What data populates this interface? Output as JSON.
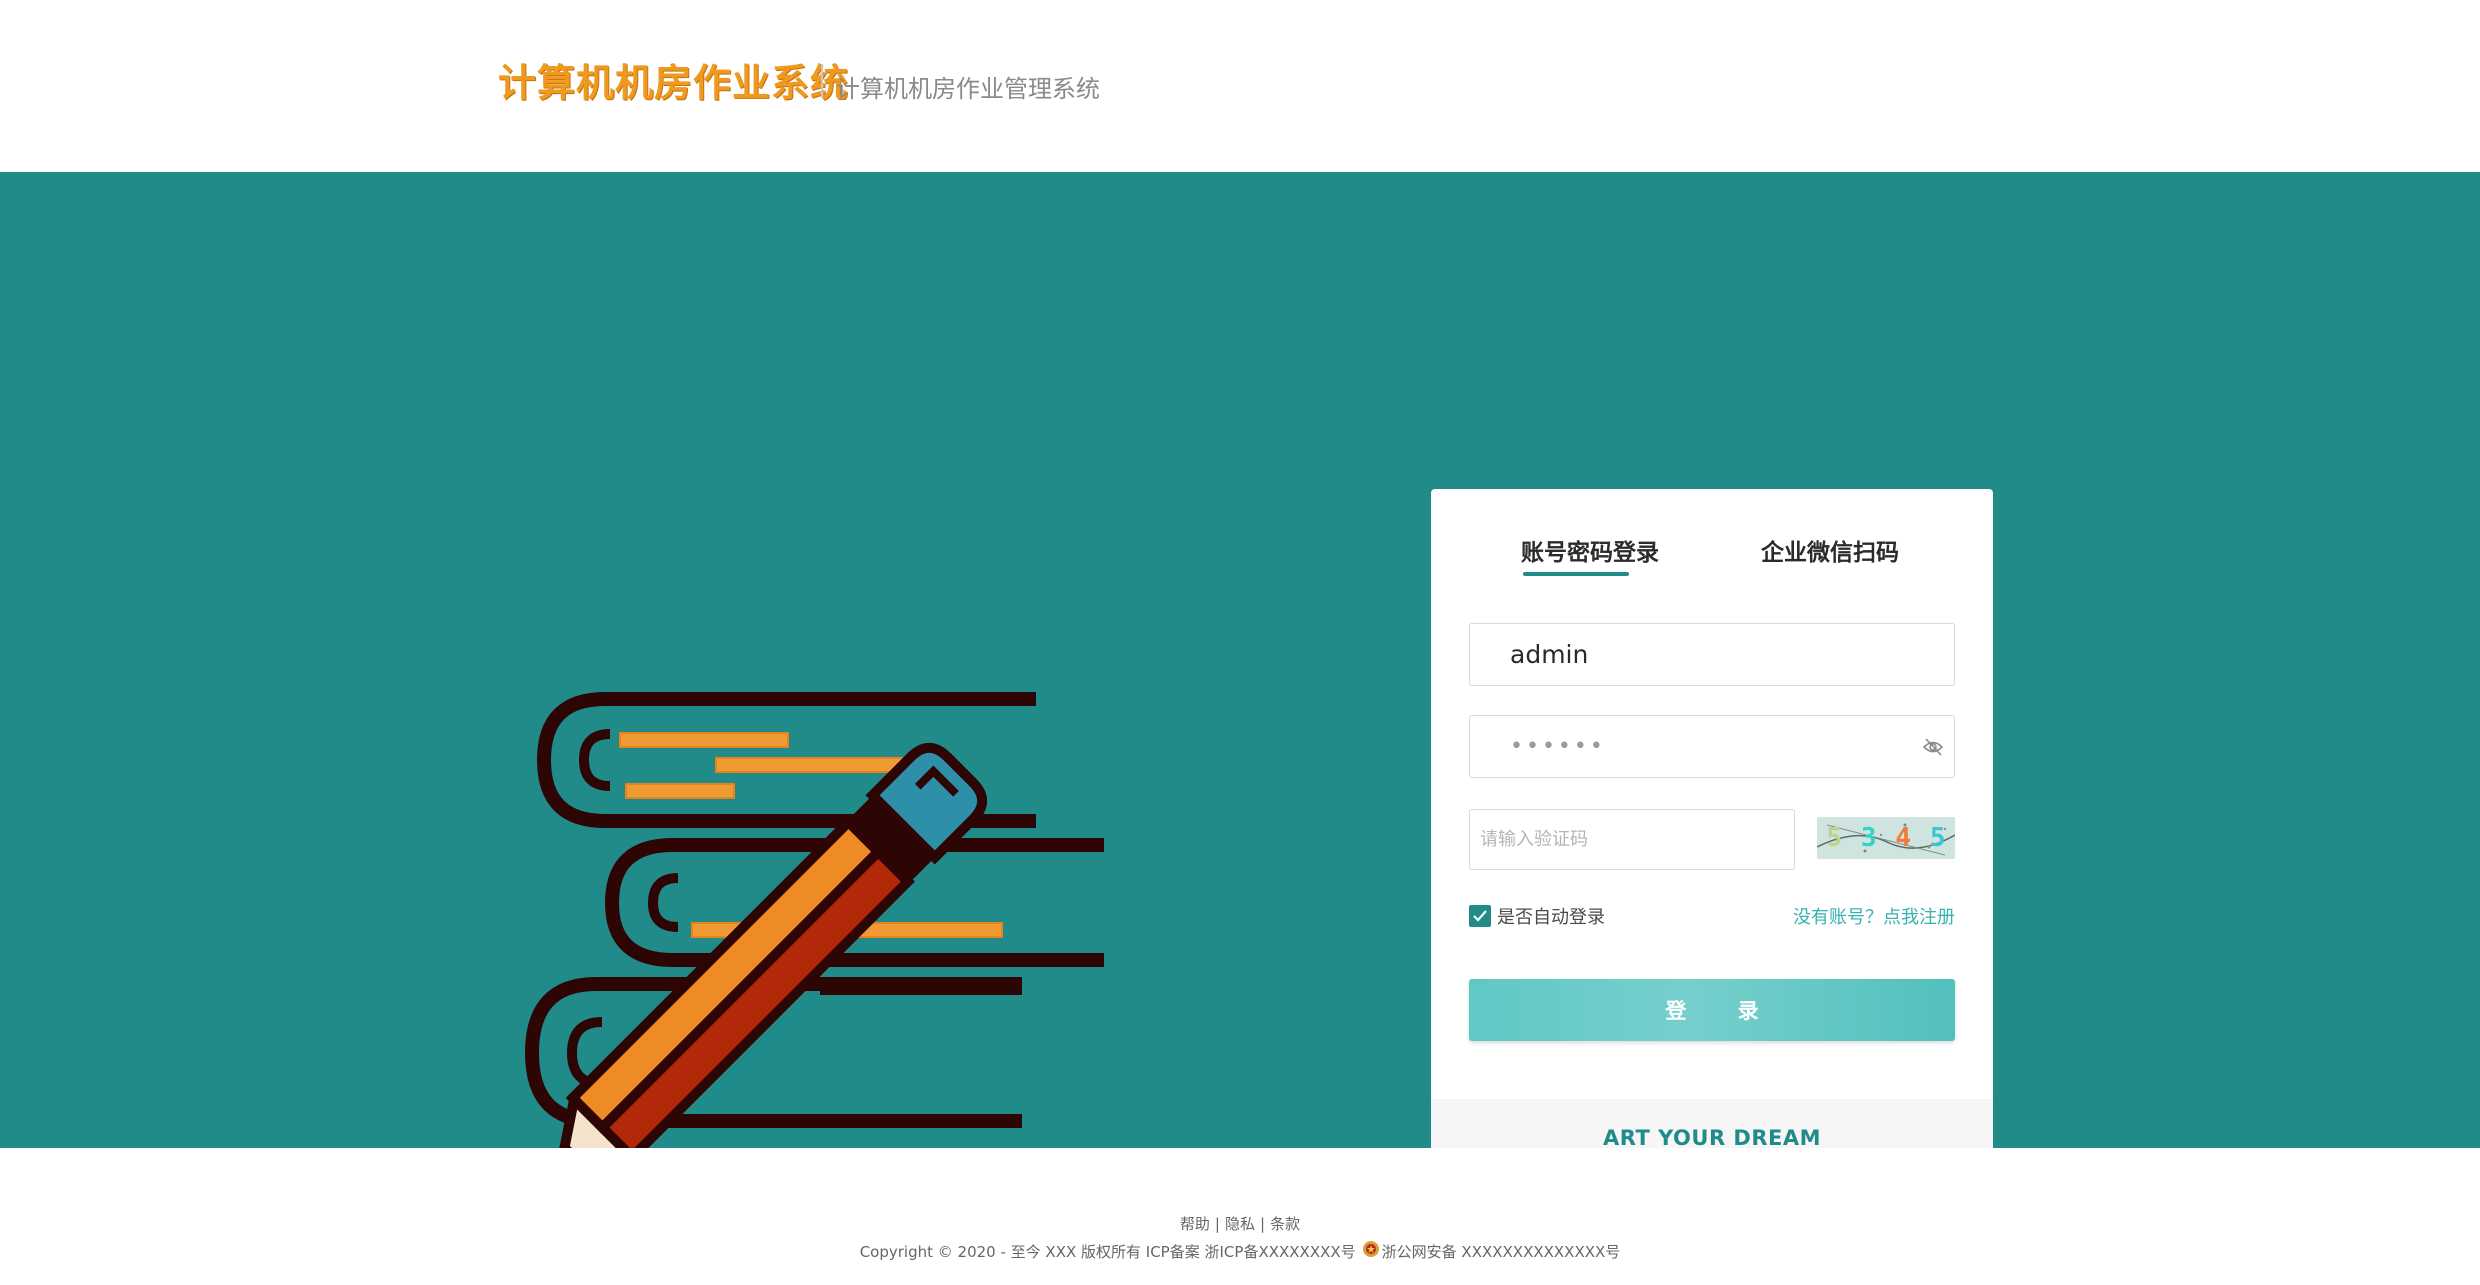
{
  "header": {
    "logo_title": "计算机机房作业系统",
    "subtitle": "计算机机房作业管理系统"
  },
  "login": {
    "tabs": [
      {
        "label": "账号密码登录",
        "active": true
      },
      {
        "label": "企业微信扫码",
        "active": false
      }
    ],
    "username_value": "admin",
    "password_mask": "••••••",
    "captcha_placeholder": "请输入验证码",
    "captcha_text": "5345",
    "autologin_label": "是否自动登录",
    "autologin_checked": true,
    "register_link": "没有账号？点我注册",
    "login_button": "登 录",
    "slogan": "ART YOUR DREAM"
  },
  "footer": {
    "links": [
      "帮助",
      "隐私",
      "条款"
    ],
    "copyright": "Copyright © 2020 - 至今 XXX 版权所有 ICP备案 浙ICP备XXXXXXXX号",
    "police_record": "浙公网安备 XXXXXXXXXXXXXX号"
  },
  "colors": {
    "teal": "#218b8a",
    "logo_orange": "#ef9a1f",
    "button": "#60c8c5",
    "link": "#37b2ae"
  },
  "icons": [
    "books-pencil-illustration",
    "eye-slash-icon",
    "check-icon",
    "police-badge-icon"
  ]
}
